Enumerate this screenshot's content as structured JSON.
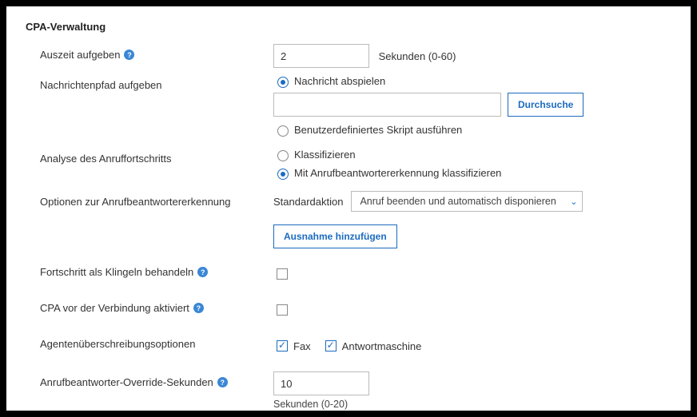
{
  "section_title": "CPA-Verwaltung",
  "abandon_timeout": {
    "label": "Auszeit aufgeben",
    "value": "2",
    "suffix": "Sekunden (0-60)"
  },
  "abandon_path": {
    "label": "Nachrichtenpfad aufgeben",
    "radio_play": "Nachricht abspielen",
    "radio_script": "Benutzerdefiniertes Skript ausführen",
    "browse": "Durchsuche",
    "path_value": ""
  },
  "cpa_analysis": {
    "label": "Analyse des Anruffortschritts",
    "radio_classify": "Klassifizieren",
    "radio_classify_am": "Mit Anrufbeantwortererkennung klassifizieren"
  },
  "am_options": {
    "label": "Optionen zur Anrufbeantwortererkennung",
    "default_action_label": "Standardaktion",
    "default_action_value": "Anruf beenden und automatisch disponieren",
    "add_exception": "Ausnahme hinzufügen"
  },
  "treat_progress": {
    "label": "Fortschritt als Klingeln behandeln"
  },
  "cpa_preconnect": {
    "label": "CPA vor der Verbindung aktiviert"
  },
  "agent_override": {
    "label": "Agentenüberschreibungsoptionen",
    "fax": "Fax",
    "am": "Antwortmaschine"
  },
  "override_seconds": {
    "label": "Anrufbeantworter-Override-Sekunden",
    "value": "10",
    "suffix": "Sekunden (0-20)"
  }
}
